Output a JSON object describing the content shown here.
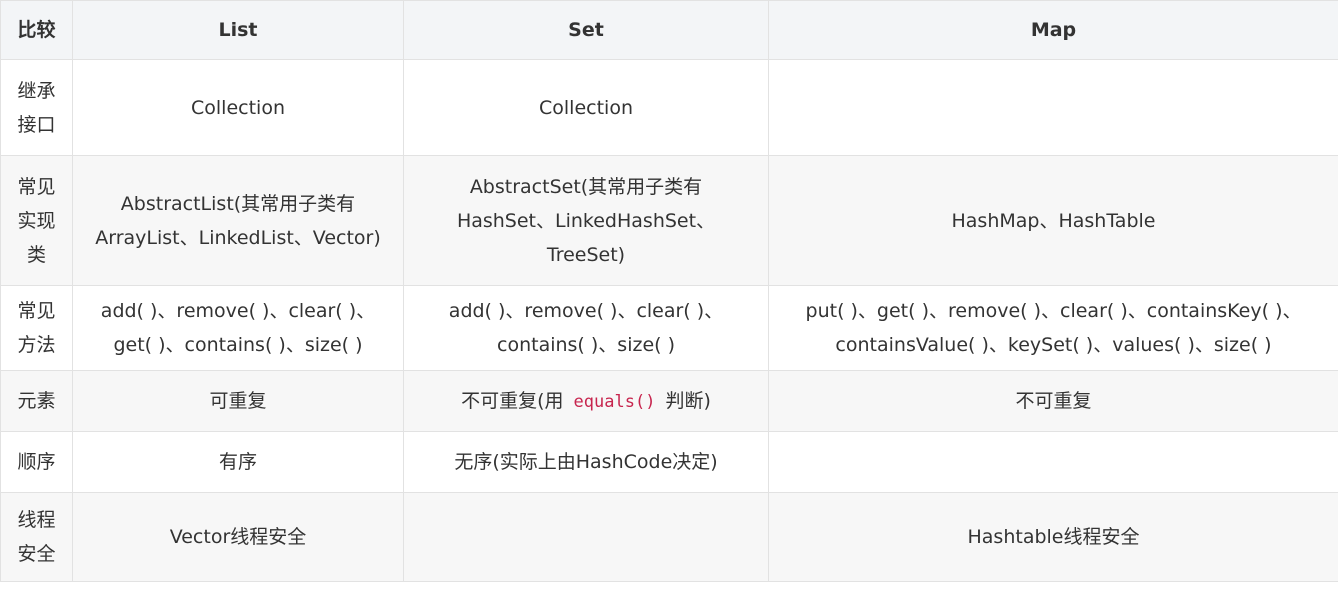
{
  "header": {
    "compare": "比较",
    "list": "List",
    "set": "Set",
    "map": "Map"
  },
  "rows": {
    "inherit": {
      "label_l1": "继承",
      "label_l2": "接口",
      "list": "Collection",
      "set": "Collection",
      "map": ""
    },
    "impl": {
      "label_l1": "常见",
      "label_l2": "实现",
      "label_l3": "类",
      "list_l1": "AbstractList(其常用子类有",
      "list_l2": "ArrayList、LinkedList、Vector)",
      "set_l1": "AbstractSet(其常用子类有",
      "set_l2": "HashSet、LinkedHashSet、",
      "set_l3": "TreeSet)",
      "map": "HashMap、HashTable"
    },
    "methods": {
      "label_l1": "常见",
      "label_l2": "方法",
      "list_l1": "add( )、remove( )、clear( )、",
      "list_l2": "get( )、contains( )、size( )",
      "set_l1": "add( )、remove( )、clear( )、",
      "set_l2": "contains( )、size( )",
      "map_l1": "put( )、get( )、remove( )、clear( )、containsKey( )、",
      "map_l2": "containsValue( )、keySet( )、values( )、size( )"
    },
    "element": {
      "label": "元素",
      "list": "可重复",
      "set_before": "不可重复(用",
      "set_code": "equals()",
      "set_after": "判断)",
      "map": "不可重复"
    },
    "order": {
      "label": "顺序",
      "list": "有序",
      "set": "无序(实际上由HashCode决定)",
      "map": ""
    },
    "thread": {
      "label_l1": "线程",
      "label_l2": "安全",
      "list": "Vector线程安全",
      "set": "",
      "map": "Hashtable线程安全"
    }
  },
  "colors": {
    "header_bg": "#f3f5f7",
    "stripe_bg": "#f7f7f7",
    "border": "#e2e2e2",
    "text": "#333333",
    "code": "#c7254e"
  }
}
